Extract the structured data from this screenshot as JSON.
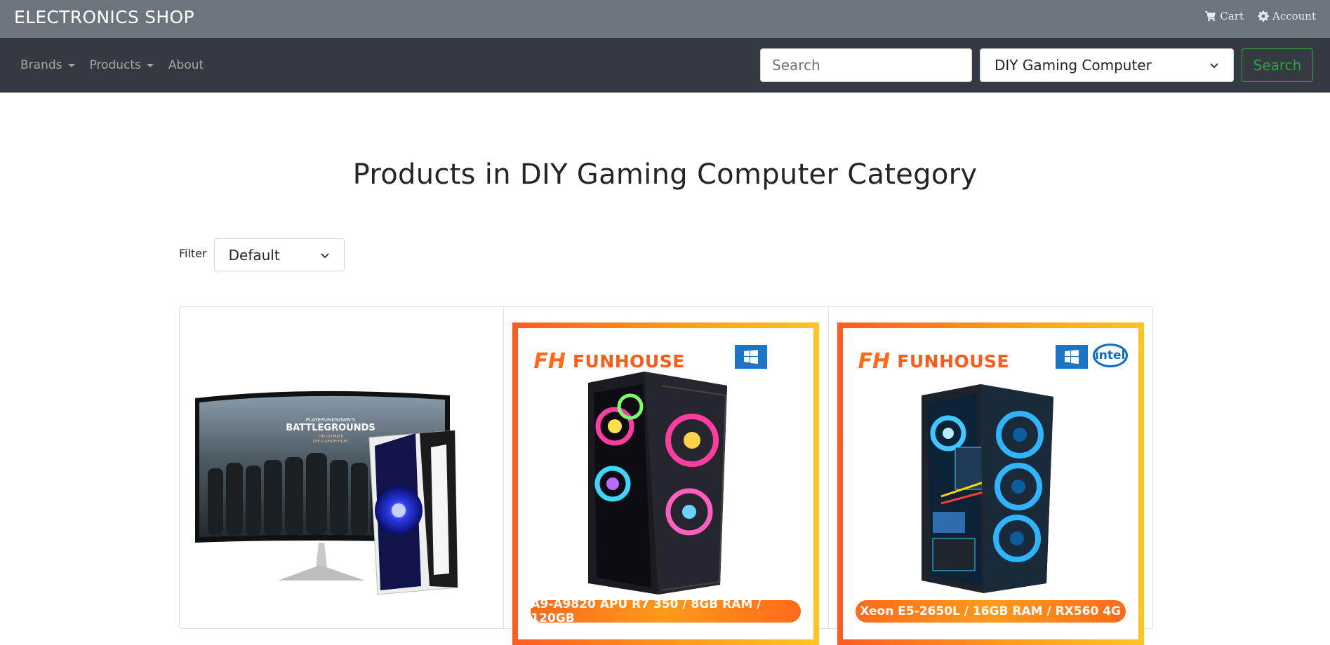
{
  "topbar": {
    "brand": "ELECTRONICS SHOP",
    "cart_label": "Cart",
    "account_label": "Account"
  },
  "navbar": {
    "brands_label": "Brands",
    "products_label": "Products",
    "about_label": "About",
    "search_placeholder": "Search",
    "category_selected": "DIY Gaming Computer",
    "search_button": "Search"
  },
  "main": {
    "title": "Products in DIY Gaming Computer Category",
    "filter_label": "Filter",
    "filter_selected": "Default"
  },
  "products": [
    {
      "image": "gaming-monitor-and-pc-bundle",
      "monitor_text_1": "PLAYERUNKNOWN'S",
      "monitor_text_2": "BATTLEGROUNDS",
      "monitor_text_3": "THE ULTIMATE",
      "monitor_text_4": "LIFE & DEATH FIGHT"
    },
    {
      "image": "funhouse-rgb-case",
      "brand": "FUNHOUSE",
      "spec": "A9-A9820 APU R7 350 / 8GB RAM / 120GB"
    },
    {
      "image": "funhouse-blue-fan-case",
      "brand": "FUNHOUSE",
      "badge": "intel",
      "spec": "Xeon E5-2650L / 16GB RAM / RX560 4G"
    }
  ],
  "colors": {
    "topbar": "#6c757d",
    "navbar": "#343a40",
    "success": "#28a745",
    "funhouse_orange": "#ff5a1a"
  }
}
